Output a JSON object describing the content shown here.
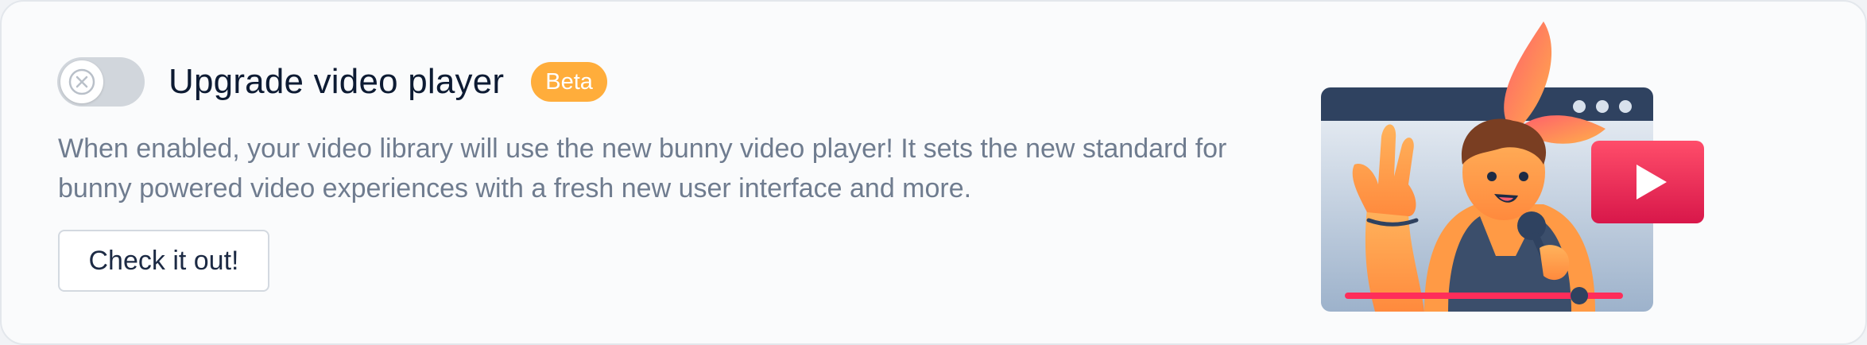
{
  "feature": {
    "toggle_state": "off",
    "title": "Upgrade video player",
    "badge": "Beta",
    "description": "When enabled, your video library will use the new bunny video player! It sets the new standard for bunny powered video experiences with a fresh new user interface and more.",
    "cta_label": "Check it out!"
  },
  "icons": {
    "toggle": "x-icon",
    "illustration": "bunny-singer-video-player-illustration"
  },
  "colors": {
    "badge_bg": "#ffad3b",
    "title": "#0d1b33",
    "description": "#6f7c8f",
    "toggle_off": "#d1d6dc",
    "accent_red": "#e8284f"
  }
}
